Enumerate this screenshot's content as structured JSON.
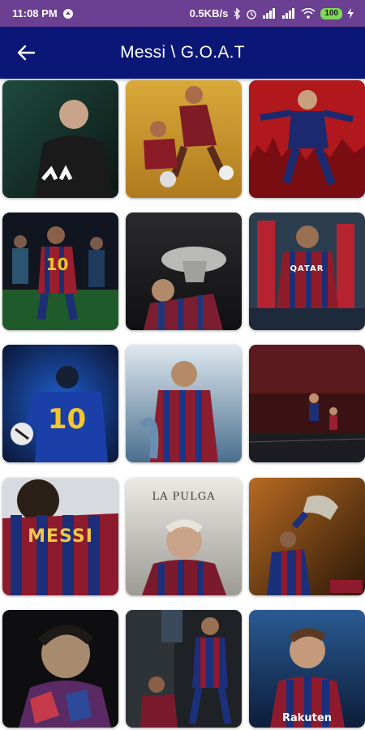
{
  "status_bar": {
    "time": "11:08 PM",
    "network_speed": "0.5KB/s",
    "battery": "100",
    "icons": [
      "notification-icon",
      "bluetooth-icon",
      "alarm-icon",
      "signal-icon",
      "signal-icon",
      "wifi-icon",
      "charging-icon"
    ]
  },
  "app_bar": {
    "back_icon": "arrow-left-icon",
    "title": "Messi \\ G.O.A.T",
    "background": "#0a1776"
  },
  "status_color": "#6b3f91",
  "wallpapers": [
    {
      "overlay_text": ""
    },
    {
      "overlay_text": ""
    },
    {
      "overlay_text": ""
    },
    {
      "overlay_text": "10"
    },
    {
      "overlay_text": ""
    },
    {
      "overlay_text": "QATAR"
    },
    {
      "overlay_text": "10"
    },
    {
      "overlay_text": ""
    },
    {
      "overlay_text": ""
    },
    {
      "overlay_text": "MESSI"
    },
    {
      "overlay_text": "LA PULGA"
    },
    {
      "overlay_text": ""
    },
    {
      "overlay_text": ""
    },
    {
      "overlay_text": ""
    },
    {
      "overlay_text": "Rakuten"
    }
  ]
}
